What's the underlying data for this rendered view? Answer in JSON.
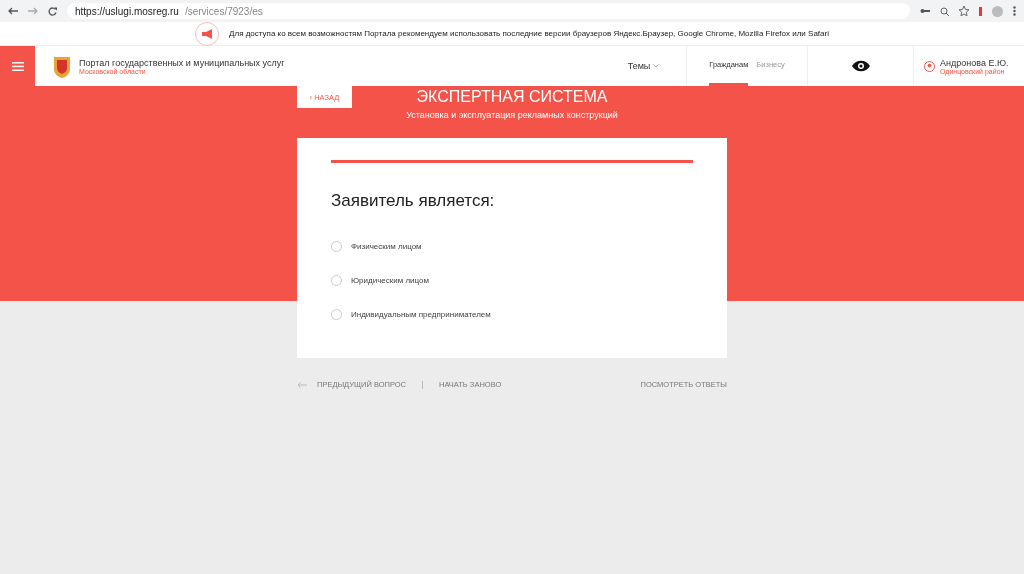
{
  "browser": {
    "url_host": "https://uslugi.mosreg.ru",
    "url_path": "/services/7923/es"
  },
  "notice": {
    "text": "Для доступа ко всем возможностям Портала рекомендуем использовать последние версии браузеров Яндекс.Браузер, Google Chrome, Mozilla Firefox или Safari"
  },
  "header": {
    "title": "Портал государственных и муниципальных услуг",
    "region": "Московской области",
    "menu": "Темы",
    "tabs": [
      {
        "label": "Гражданам",
        "selected": true
      },
      {
        "label": "Бизнесу",
        "selected": false
      }
    ],
    "user": {
      "name": "Андронова Е.Ю.",
      "district": "Одинцовский район"
    }
  },
  "back": "‹ НАЗАД",
  "hero": {
    "title": "ЭКСПЕРТНАЯ СИСТЕМА",
    "subtitle": "Установка и эксплуатация рекламных конструкций"
  },
  "question": {
    "title": "Заявитель является:",
    "options": [
      {
        "label": "Физическим лицом",
        "selected": false
      },
      {
        "label": "Юридическим лицом",
        "selected": false
      },
      {
        "label": "Индивидуальным предпринимателем",
        "selected": false
      }
    ]
  },
  "footer": {
    "previous": "ПРЕДЫДУЩИЙ ВОПРОС",
    "restart": "НАЧАТЬ ЗАНОВО",
    "answers": "ПОСМОТРЕТЬ ОТВЕТЫ"
  }
}
